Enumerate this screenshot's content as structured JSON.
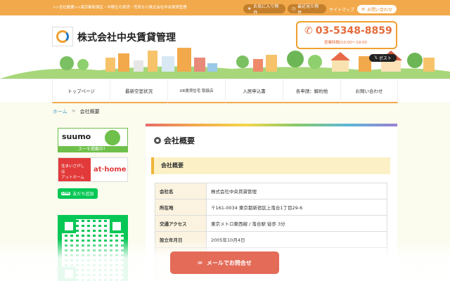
{
  "topbar": {
    "tagline": ">>全社概要>>東京都新宿区・中野区の賃貸・売買なら株式会社中央賃貸管理",
    "favorites_label": "お気に入り物件",
    "recent_label": "最近見た物件",
    "sitemap_label": "サイトマップ",
    "contact_label": "お問い合わせ"
  },
  "header": {
    "company_name": "株式会社中央賃貸管理",
    "phone": "03-5348-8859",
    "hours": "営業時間/10:00～19:00",
    "post_label": "ポスト"
  },
  "nav": {
    "items": [
      {
        "label": "トップページ"
      },
      {
        "label": "最新空室状況"
      },
      {
        "label": "UR賃貸住宅 取扱店"
      },
      {
        "label": "入居申込書"
      },
      {
        "label": "各申請：解約他"
      },
      {
        "label": "お問い合わせ"
      }
    ]
  },
  "breadcrumb": {
    "home": "ホーム",
    "separator": ">",
    "current": "会社概要"
  },
  "sidebar": {
    "suumo_word": "suumo",
    "suumo_sub": "スーモ掲載中！",
    "athome_left": "住まいさがしは\nアットホーム",
    "athome_logo": "at·home",
    "line_badge": "LINE",
    "line_label": "友だち追加"
  },
  "main": {
    "title": "会社概要",
    "section_title": "会社概要",
    "rows": [
      {
        "key": "会社名",
        "value": "株式会社中央賃貸管理"
      },
      {
        "key": "所在地",
        "value": "〒161-0034 東京都新宿区上落合1丁目29-6"
      },
      {
        "key": "交通アクセス",
        "value": "東京メトロ東西線 / 落合駅 徒歩 3分"
      },
      {
        "key": "設立年月日",
        "value": "2005年10月4日"
      }
    ]
  },
  "cta": {
    "label": "メールでお問合せ"
  },
  "colors": {
    "accent": "#f2a94b",
    "phone": "#e46b3a",
    "line": "#06c755",
    "cta": "#e46b58"
  },
  "icons": [
    "star-icon",
    "clock-icon",
    "mail-icon",
    "phone-icon",
    "x-logo-icon",
    "circle-bullet-icon"
  ]
}
